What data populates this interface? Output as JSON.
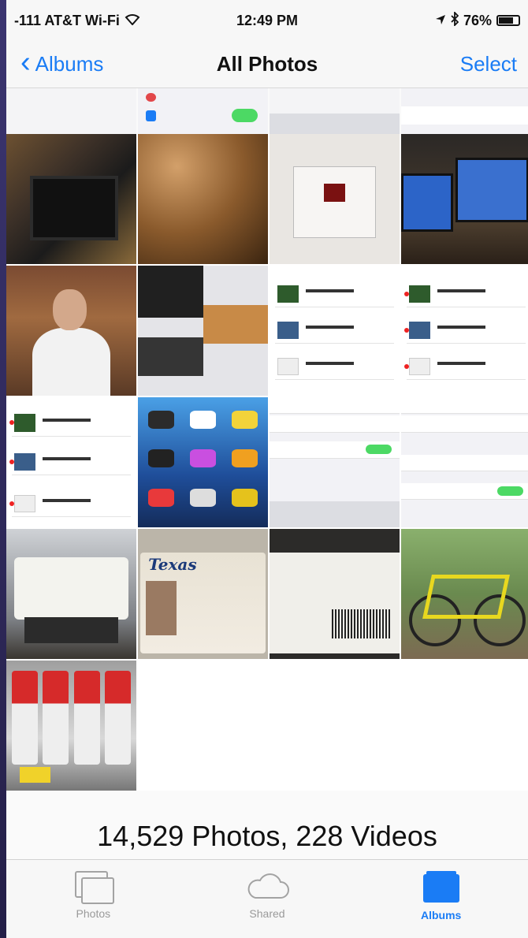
{
  "status_bar": {
    "carrier": "-111 AT&T Wi-Fi",
    "wifi_icon": "wifi-icon",
    "time": "12:49 PM",
    "location_icon": "location-arrow-icon",
    "bluetooth_icon": "bluetooth-icon",
    "battery": "76%"
  },
  "nav": {
    "back_label": "Albums",
    "title": "All Photos",
    "select_label": "Select"
  },
  "photo_tiles": {
    "top_row": [
      "settings-screenshot",
      "settings-toggles",
      "keyboard-screenshot",
      "icloud-settings"
    ],
    "rows": [
      [
        "monitor-photo",
        "blurred-brown-photo",
        "mac-os-x-login",
        "dual-monitor-desk"
      ],
      [
        "man-portrait",
        "screenshot-collage",
        "notes-list-screenshot",
        "notes-list-screenshot-2"
      ],
      [
        "notes-list-screenshot-3",
        "iphone-home-screen",
        "touch-id-settings",
        "notes-settings"
      ],
      [
        "printer-photo",
        "texas-license-photo",
        "card-barcode-photo",
        "yellow-bike-photo"
      ],
      [
        "store-shelf-photo"
      ]
    ],
    "texas_label": "Texas"
  },
  "summary": {
    "count_text": "14,529 Photos, 228 Videos"
  },
  "tab_bar": {
    "tabs": [
      {
        "label": "Photos",
        "icon": "photos-tab-icon",
        "active": false
      },
      {
        "label": "Shared",
        "icon": "cloud-icon",
        "active": false
      },
      {
        "label": "Albums",
        "icon": "albums-icon",
        "active": true
      }
    ]
  },
  "colors": {
    "accent": "#1a7cf5",
    "toggle_on": "#4cd964"
  }
}
